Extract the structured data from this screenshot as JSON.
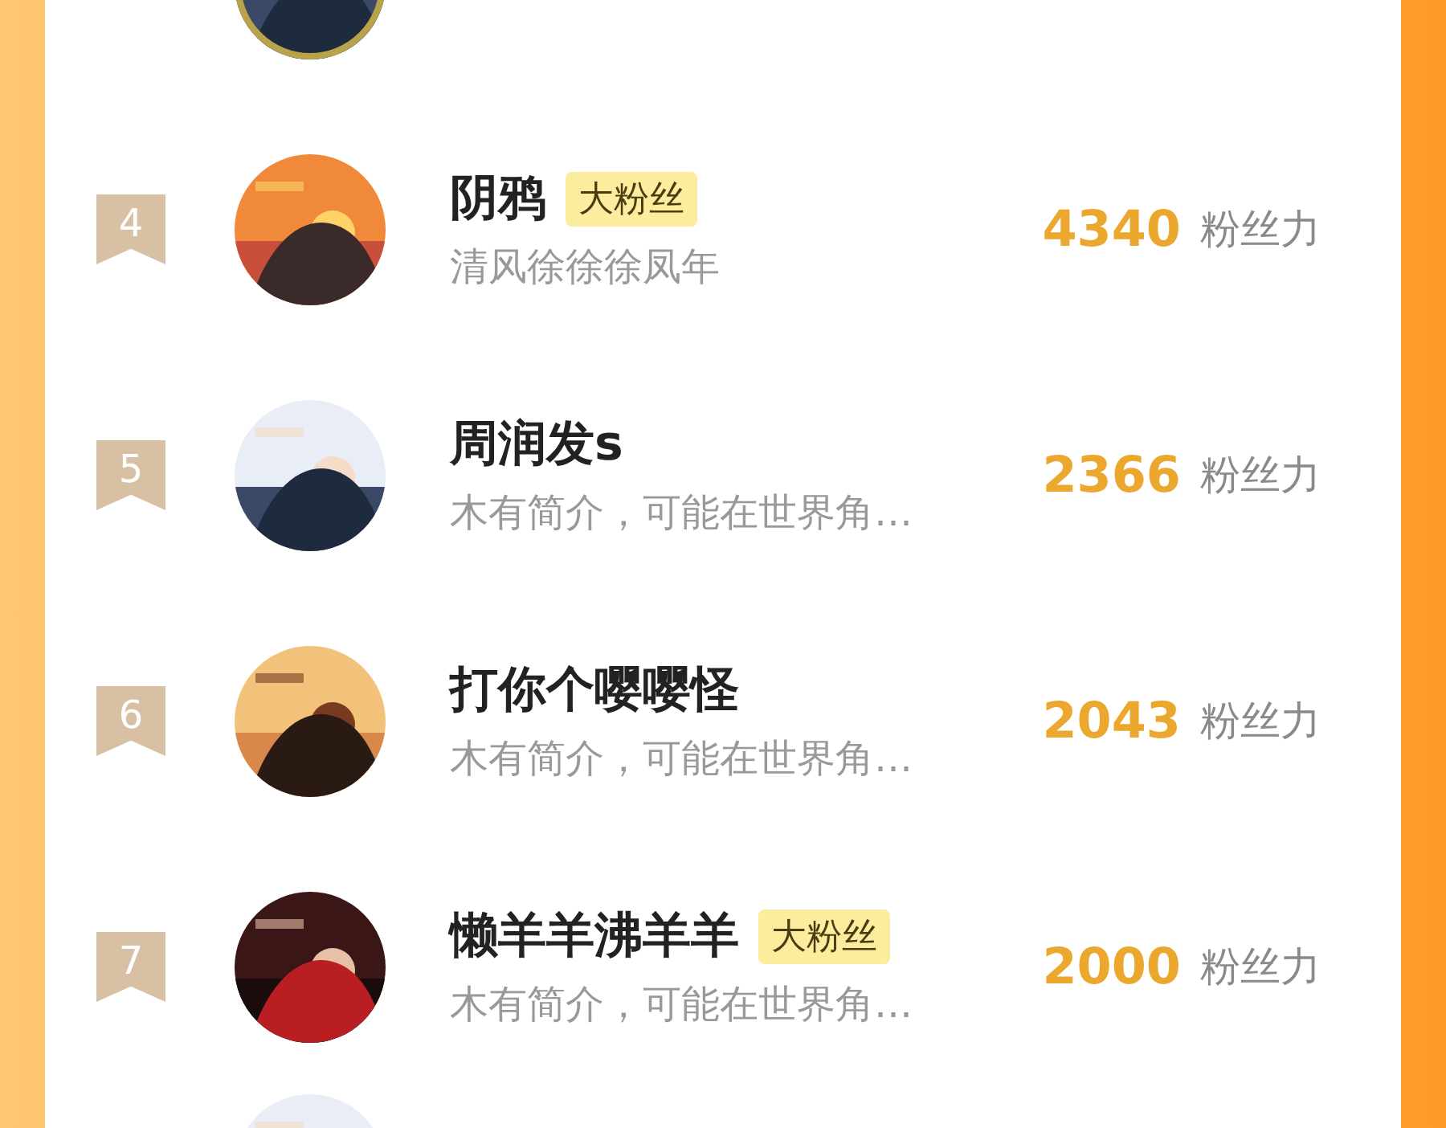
{
  "rows": [
    {
      "rank": "4",
      "name": "阴鸦",
      "badge": "大粉丝",
      "bio": "清风徐徐徐凤年",
      "score": "4340",
      "unit": "粉丝力"
    },
    {
      "rank": "5",
      "name": "周润发s",
      "bio": "木有简介，可能在世界角…",
      "score": "2366",
      "unit": "粉丝力"
    },
    {
      "rank": "6",
      "name": "打你个嘤嘤怪",
      "bio": "木有简介，可能在世界角…",
      "score": "2043",
      "unit": "粉丝力"
    },
    {
      "rank": "7",
      "name": "懒羊羊沸羊羊",
      "badge": "大粉丝",
      "bio": "木有简介，可能在世界角…",
      "score": "2000",
      "unit": "粉丝力"
    }
  ]
}
